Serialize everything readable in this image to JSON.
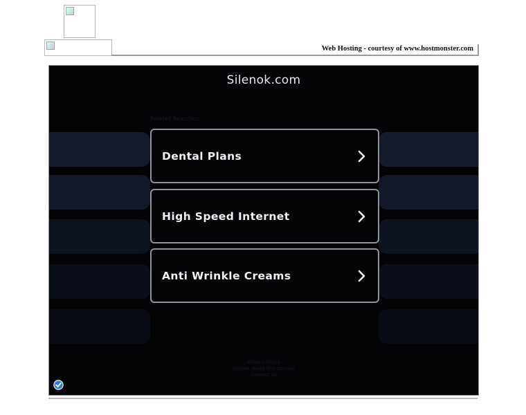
{
  "header": {
    "hosting_text": "Web Hosting - courtesy of www.hostmonster.com"
  },
  "site": {
    "title": "Silenok.com",
    "related_label": "Related Searches:"
  },
  "links": [
    {
      "label": "Dental Plans"
    },
    {
      "label": "High Speed Internet"
    },
    {
      "label": "Anti Wrinkle Creams"
    }
  ],
  "footer": {
    "privacy": "Privacy Policy",
    "inquire": "Inquire about this domain",
    "contact": "Contact us"
  },
  "colors": {
    "frame_bg": "#040407",
    "ghost_bar": "#151b2a",
    "link_border": "#8f9297"
  }
}
